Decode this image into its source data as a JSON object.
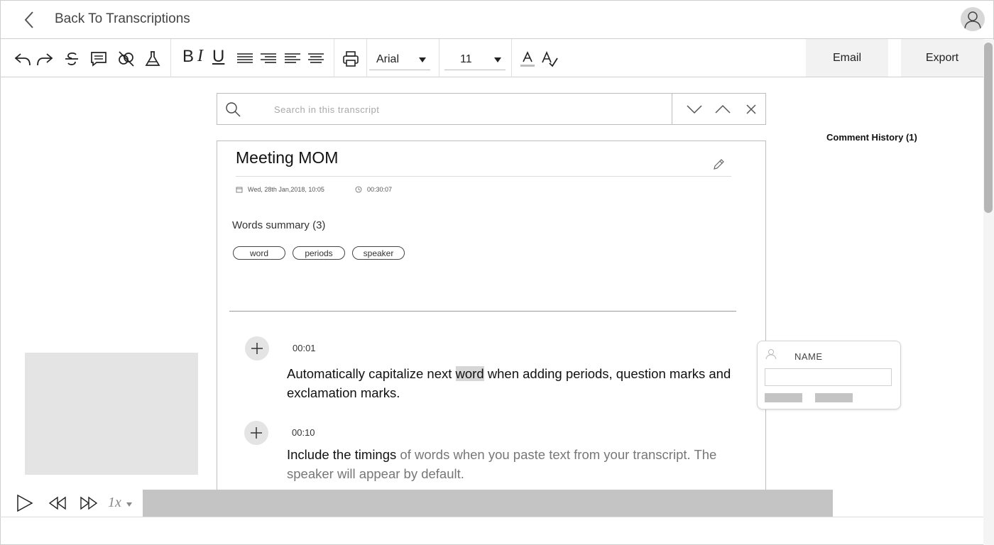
{
  "header": {
    "back_label": "Back To Transcriptions"
  },
  "toolbar": {
    "icons": [
      "undo-icon",
      "redo-icon",
      "strikethrough-icon",
      "comment-icon",
      "unlink-icon",
      "flask-icon",
      "print-icon",
      "font-color-icon",
      "spell-check-icon"
    ],
    "bold_label": "B",
    "italic_label": "I",
    "underline_label": "U",
    "font": {
      "selected": "Arial"
    },
    "font_size": {
      "selected": "11"
    },
    "email_label": "Email",
    "export_label": "Export"
  },
  "search": {
    "placeholder": "Search in this transcript"
  },
  "comment_history": {
    "label": "Comment History (1)"
  },
  "transcript": {
    "title": "Meeting MOM",
    "date": "Wed, 28th Jan,2018, 10:05",
    "duration": "00:30:07",
    "words_summary_label": "Words summary (3)",
    "tags": [
      "word",
      "periods",
      "speaker"
    ],
    "entries": [
      {
        "time": "00:01",
        "text_before": "Automatically capitalize next ",
        "highlight": "word",
        "text_after": " when adding periods, question marks and exclamation marks."
      },
      {
        "time": "00:10",
        "text_strong": "Include the timings",
        "text_muted": " of words when you paste text from your transcript. The speaker will appear by default."
      }
    ]
  },
  "comment_card": {
    "name_label": "NAME"
  },
  "player": {
    "speed": "1x"
  },
  "colors": {
    "border": "#cfcfcf",
    "chip_border": "#444444",
    "highlight": "#d6d6d6",
    "placeholder_fill": "#e4e4e4",
    "progress": "#c4c4c4"
  }
}
